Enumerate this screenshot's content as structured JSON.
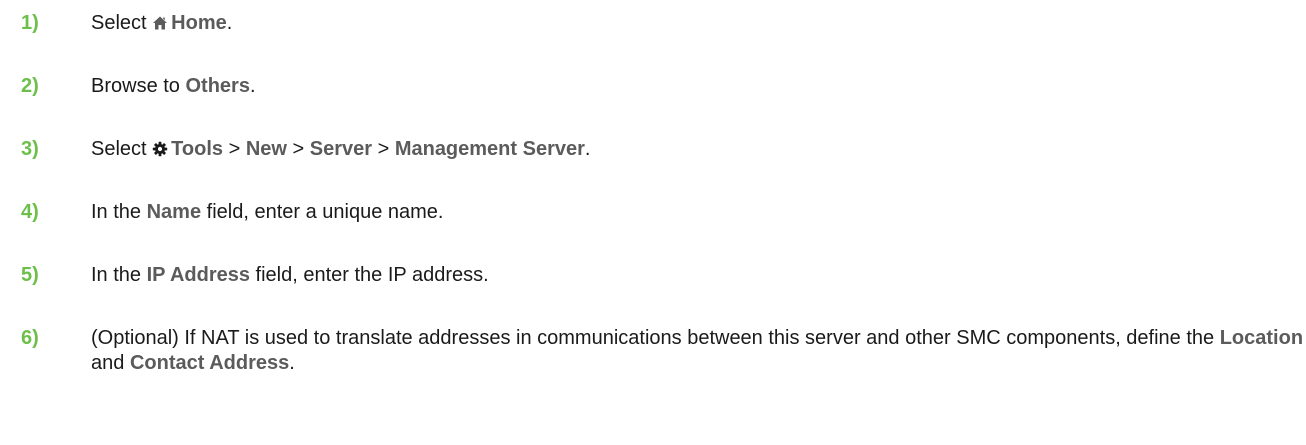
{
  "steps": [
    {
      "number": "1)",
      "t1": "Select ",
      "icon": "home-icon",
      "ui1": "Home",
      "t2": "."
    },
    {
      "number": "2)",
      "t1": "Browse to ",
      "ui1": "Others",
      "t2": "."
    },
    {
      "number": "3)",
      "t1": "Select ",
      "icon": "gear-icon",
      "ui1": "Tools",
      "sep1": " > ",
      "ui2": "New",
      "sep2": " > ",
      "ui3": "Server",
      "sep3": " > ",
      "ui4": "Management Server",
      "t2": "."
    },
    {
      "number": "4)",
      "t1": "In the ",
      "ui1": "Name",
      "t2": " field, enter a unique name."
    },
    {
      "number": "5)",
      "t1": "In the ",
      "ui1": "IP Address",
      "t2": " field, enter the IP address."
    },
    {
      "number": "6)",
      "t1": "(Optional) If NAT is used to translate addresses in communications between this server and other SMC components, define the ",
      "ui1": "Location",
      "t2": " and ",
      "ui2": "Contact Address",
      "t3": "."
    }
  ],
  "colors": {
    "step_number": "#6cc04a",
    "ui_term": "#5b5b5b",
    "body_text": "#1a1a1a"
  }
}
